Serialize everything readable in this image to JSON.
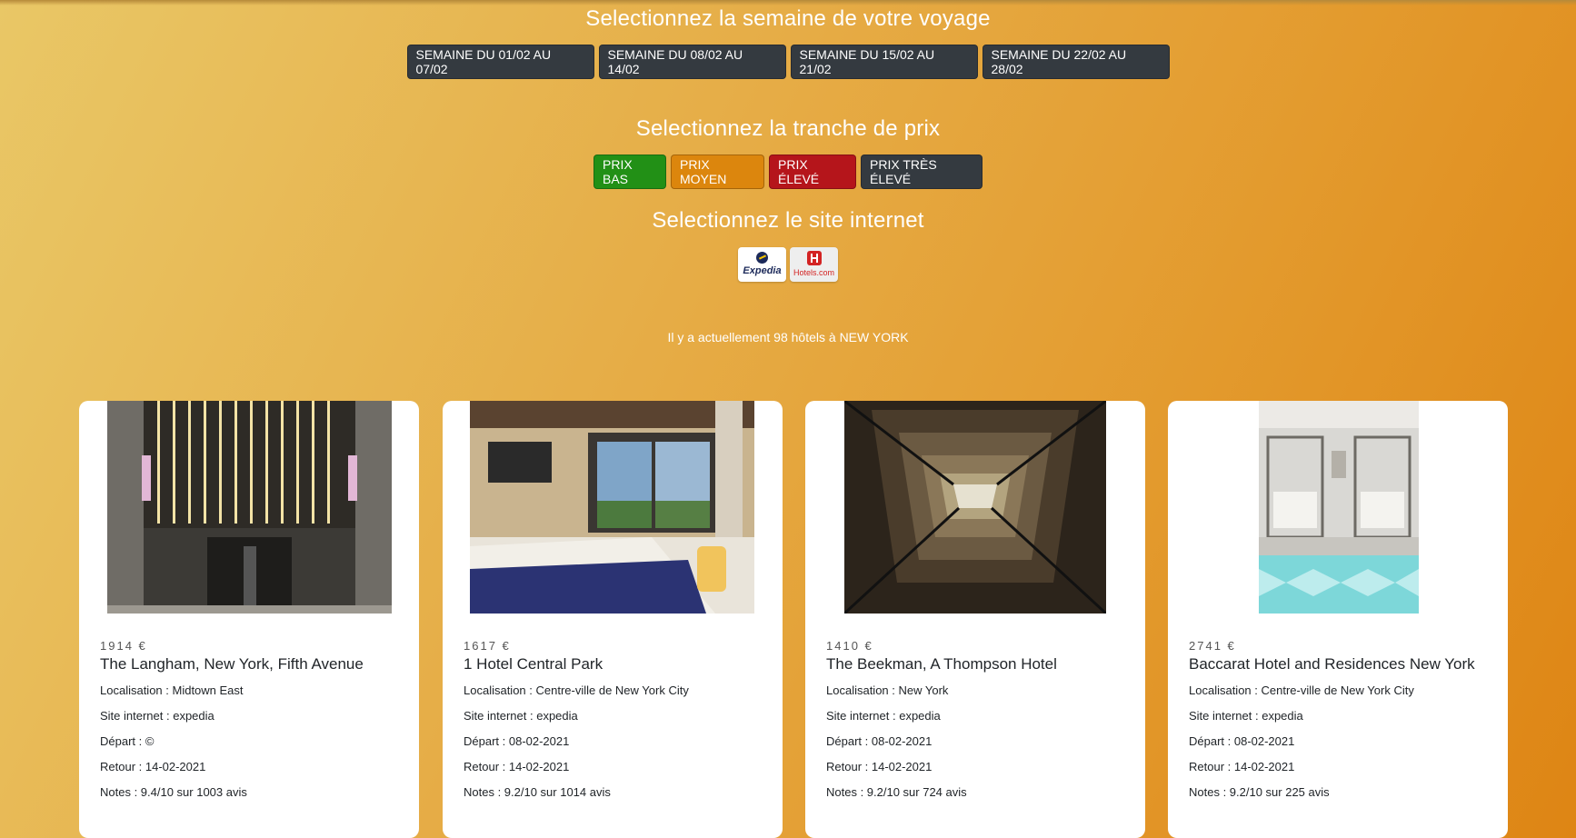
{
  "weeks": {
    "title": "Selectionnez la semaine de votre voyage",
    "buttons": [
      "SEMAINE DU 01/02 AU 07/02",
      "SEMAINE DU 08/02 AU 14/02",
      "SEMAINE DU 15/02 AU 21/02",
      "SEMAINE DU 22/02 AU 28/02"
    ]
  },
  "prices": {
    "title": "Selectionnez la tranche de prix",
    "buttons": [
      "PRIX BAS",
      "PRIX MOYEN",
      "PRIX ÉLEVÉ",
      "PRIX TRÈS ÉLEVÉ"
    ],
    "colors": [
      "#229016",
      "#dc860d",
      "#b5151b",
      "#343a40"
    ]
  },
  "sites": {
    "title": "Selectionnez le site internet",
    "logos": [
      "Expedia",
      "Hotels.com"
    ]
  },
  "summary": "Il y a actuellement 98 hôtels à NEW YORK",
  "hotels": [
    {
      "price": "1914 €",
      "name": "The Langham, New York, Fifth Avenue",
      "location": "Localisation : Midtown East",
      "site": "Site internet : expedia",
      "departure": "Départ : ©",
      "return": "Retour : 14-02-2021",
      "rating": "Notes : 9.4/10 sur 1003 avis"
    },
    {
      "price": "1617 €",
      "name": "1 Hotel Central Park",
      "location": "Localisation : Centre-ville de New York City",
      "site": "Site internet : expedia",
      "departure": "Départ : 08-02-2021",
      "return": "Retour : 14-02-2021",
      "rating": "Notes : 9.2/10 sur 1014 avis"
    },
    {
      "price": "1410 €",
      "name": "The Beekman, A Thompson Hotel",
      "location": "Localisation : New York",
      "site": "Site internet : expedia",
      "departure": "Départ : 08-02-2021",
      "return": "Retour : 14-02-2021",
      "rating": "Notes : 9.2/10 sur 724 avis"
    },
    {
      "price": "2741 €",
      "name": "Baccarat Hotel and Residences New York",
      "location": "Localisation : Centre-ville de New York City",
      "site": "Site internet : expedia",
      "departure": "Départ : 08-02-2021",
      "return": "Retour : 14-02-2021",
      "rating": "Notes : 9.2/10 sur 225 avis"
    }
  ]
}
